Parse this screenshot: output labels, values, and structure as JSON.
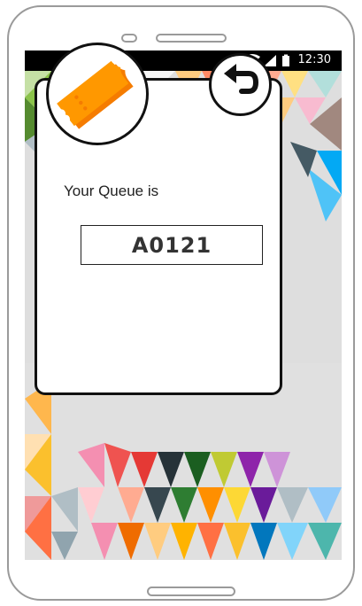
{
  "status_bar": {
    "time": "12:30",
    "icons": [
      "wifi-icon",
      "signal-icon",
      "battery-icon"
    ]
  },
  "dialog": {
    "ticket_icon": "ticket-icon",
    "back_icon": "undo-arrow-icon",
    "queue_label": "Your Queue is",
    "queue_number": "A0121"
  },
  "colors": {
    "ticket": "#ff9800",
    "ticket_dark": "#f57c00",
    "card_border": "#111111",
    "status_bar": "#000000"
  }
}
